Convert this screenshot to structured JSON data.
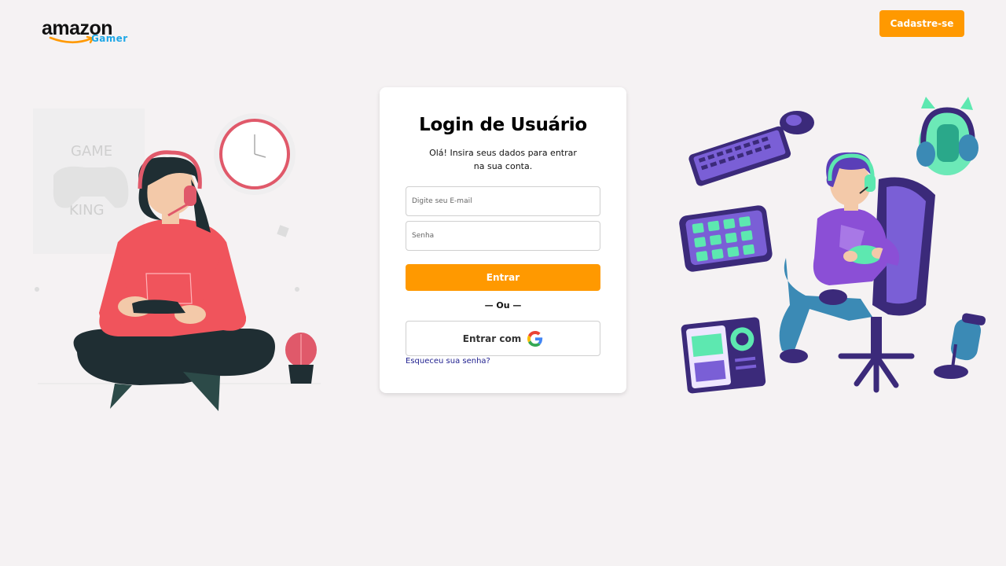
{
  "header": {
    "logo_brand": "amazon",
    "logo_sub": "Gamer",
    "signup_label": "Cadastre-se"
  },
  "login": {
    "title": "Login de Usuário",
    "subtitle": "Olá! Insira seus dados para entrar na sua conta.",
    "email_placeholder": "Digite seu E-mail",
    "password_placeholder": "Senha",
    "submit_label": "Entrar",
    "divider_label": "— Ou —",
    "google_label": "Entrar com",
    "forgot_label": "Esqueceu sua senha?"
  },
  "illustrations": {
    "left_sign_line1": "GAME",
    "left_sign_line2": "KING"
  },
  "colors": {
    "accent": "#ff9900",
    "background": "#f5f2f3",
    "logo_sub": "#1ea7e6",
    "link": "#1f1f8f"
  },
  "icons": [
    "amazon-smile-icon",
    "google-icon",
    "gamer-girl-illustration",
    "gamer-boy-illustration"
  ]
}
